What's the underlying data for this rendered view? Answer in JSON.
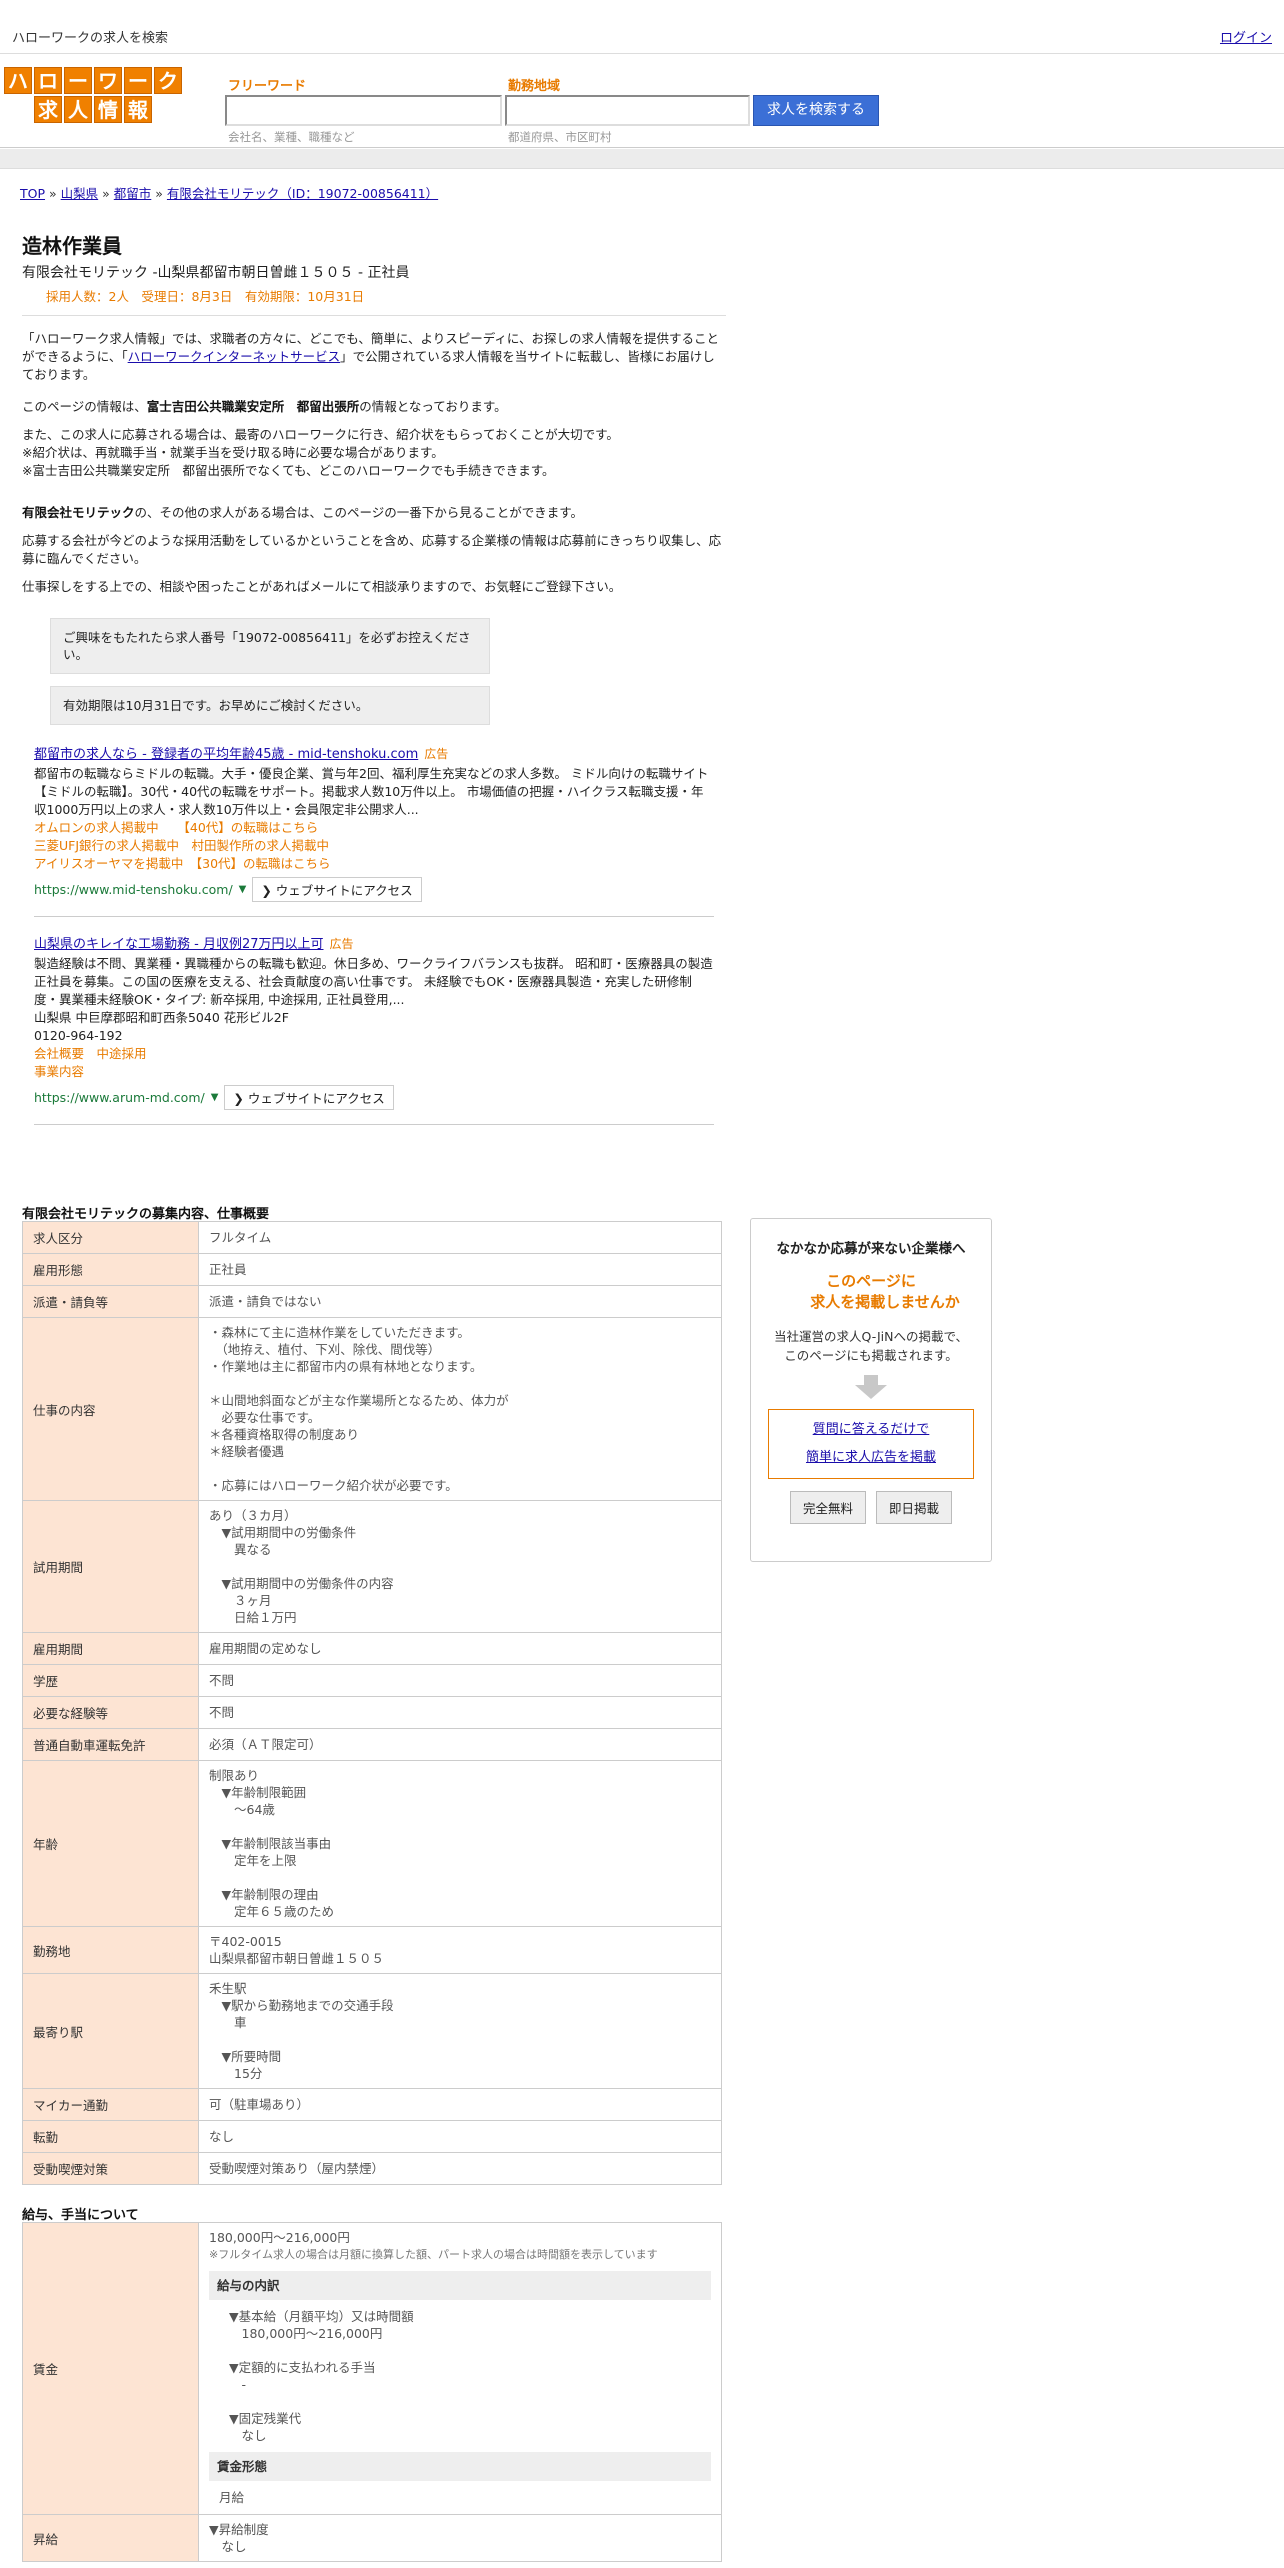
{
  "topbar": {
    "site_title": "ハローワークの求人を検索",
    "login": "ログイン"
  },
  "header": {
    "logo_row1": [
      "ハ",
      "ロ",
      "ー",
      "ワ",
      "ー",
      "ク"
    ],
    "logo_row2": [
      "求",
      "人",
      "情",
      "報"
    ],
    "freeword_label": "フリーワード",
    "freeword_hint": "会社名、業種、職種など",
    "area_label": "勤務地域",
    "area_hint": "都道府県、市区町村",
    "search_button": "求人を検索する"
  },
  "breadcrumb": {
    "items": [
      "TOP",
      "山梨県",
      "都留市",
      "有限会社モリテック（ID：19072-00856411）"
    ],
    "separator": "»"
  },
  "job": {
    "title": "造林作業員",
    "company_line": "有限会社モリテック -山梨県都留市朝日曽雌１５０５ - 正社員",
    "meta": "採用人数：2人　受理日：8月3日　有効期限：10月31日"
  },
  "intro": {
    "p1_a": "「ハローワーク求人情報」では、求職者の方々に、どこでも、簡単に、よりスピーディに、お探しの求人情報を提供することができるように、「",
    "p1_link": "ハローワークインターネットサービス",
    "p1_b": "」で公開されている求人情報を当サイトに転載し、皆様にお届けしております。",
    "p2_a": "このページの情報は、",
    "p2_bold": "富士吉田公共職業安定所　都留出張所",
    "p2_b": "の情報となっております。",
    "p3": "また、この求人に応募される場合は、最寄のハローワークに行き、紹介状をもらっておくことが大切です。\n※紹介状は、再就職手当・就業手当を受け取る時に必要な場合があります。\n※富士吉田公共職業安定所　都留出張所でなくても、どこのハローワークでも手続きできます。",
    "p4_bold": "有限会社モリテック",
    "p4_b": "の、その他の求人がある場合は、このページの一番下から見ることができます。",
    "p5": "応募する会社が今どのような採用活動をしているかということを含め、応募する企業様の情報は応募前にきっちり収集し、応募に臨んでください。",
    "p6": "仕事探しをする上での、相談や困ったことがあればメールにて相談承りますので、お気軽にご登録下さい。",
    "notice1": "ご興味をもたれたら求人番号「19072-00856411」を必ずお控えください。",
    "notice2": "有効期限は10月31日です。お早めにご検討ください。"
  },
  "ads": [
    {
      "title": "都留市の求人なら - 登録者の平均年齢45歳 - mid-tenshoku.com",
      "tag": "広告",
      "desc": "都留市の転職ならミドルの転職。大手・優良企業、賞与年2回、福利厚生充実などの求人多数。 ミドル向けの転職サイト【ミドルの転職】。30代・40代の転職をサポート。掲載求人数10万件以上。 市場価値の把握・ハイクラス転職支援・年収1000万円以上の求人・求人数10万件以上・会員限定非公開求人...",
      "links": [
        "オムロンの求人掲載中　　【40代】の転職はこちら",
        "三菱UFJ銀行の求人掲載中　村田製作所の求人掲載中",
        "アイリスオーヤマを掲載中　【30代】の転職はこちら"
      ],
      "url": "https://www.mid-tenshoku.com/",
      "visit": "❯ ウェブサイトにアクセス"
    },
    {
      "title": "山梨県のキレイな工場勤務 - 月収例27万円以上可",
      "tag": "広告",
      "desc": "製造経験は不問、異業種・異職種からの転職も歓迎。休日多め、ワークライフバランスも抜群。 昭和町・医療器具の製造正社員を募集。この国の医療を支える、社会貢献度の高い仕事です。 未経験でもOK・医療器具製造・充実した研修制度・異業種未経験OK・タイプ: 新卒採用, 中途採用, 正社員登用,...\n山梨県 中巨摩郡昭和町西条5040 花形ビル2F\n0120-964-192",
      "links": [
        "会社概要　中途採用",
        "事業内容"
      ],
      "url": "https://www.arum-md.com/",
      "visit": "❯ ウェブサイトにアクセス"
    }
  ],
  "job_summary": {
    "title": "有限会社モリテックの募集内容、仕事概要",
    "rows": [
      {
        "label": "求人区分",
        "value": "フルタイム"
      },
      {
        "label": "雇用形態",
        "value": "正社員"
      },
      {
        "label": "派遣・請負等",
        "value": "派遣・請負ではない"
      },
      {
        "label": "仕事の内容",
        "value": "・森林にて主に造林作業をしていただきます。\n　（地拵え、植付、下刈、除伐、間伐等）\n・作業地は主に都留市内の県有林地となります。\n\n＊山間地斜面などが主な作業場所となるため、体力が\n　必要な仕事です。\n＊各種資格取得の制度あり\n＊経験者優遇\n\n・応募にはハローワーク紹介状が必要です。"
      },
      {
        "label": "試用期間",
        "value": "あり（３カ月）\n　▼試用期間中の労働条件\n　　異なる\n\n　▼試用期間中の労働条件の内容\n　　３ヶ月\n　　日給１万円"
      },
      {
        "label": "雇用期間",
        "value": "雇用期間の定めなし"
      },
      {
        "label": "学歴",
        "value": "不問"
      },
      {
        "label": "必要な経験等",
        "value": "不問"
      },
      {
        "label": "普通自動車運転免許",
        "value": "必須（ＡＴ限定可）"
      },
      {
        "label": "年齢",
        "value": "制限あり\n　▼年齢制限範囲\n　　〜64歳\n\n　▼年齢制限該当事由\n　　定年を上限\n\n　▼年齢制限の理由\n　　定年６５歳のため"
      },
      {
        "label": "勤務地",
        "value": "〒402-0015\n山梨県都留市朝日曽雌１５０５"
      },
      {
        "label": "最寄り駅",
        "value": "禾生駅\n　▼駅から勤務地までの交通手段\n　　車\n\n　▼所要時間\n　　15分"
      },
      {
        "label": "マイカー通勤",
        "value": "可（駐車場あり）"
      },
      {
        "label": "転勤",
        "value": "なし"
      },
      {
        "label": "受動喫煙対策",
        "value": "受動喫煙対策あり（屋内禁煙）"
      }
    ]
  },
  "pay": {
    "title": "給与、手当について",
    "wage_label": "賃金",
    "wage_value": "180,000円〜216,000円",
    "wage_note": "※フルタイム求人の場合は月額に換算した額、パート求人の場合は時間額を表示しています",
    "breakdown_head": "給与の内訳",
    "breakdown": "▼基本給（月額平均）又は時間額\n　180,000円〜216,000円\n\n▼定額的に支払われる手当\n　-\n\n▼固定残業代\n　なし",
    "form_head": "賃金形態",
    "form_value": "月給",
    "raise_label": "昇給",
    "raise_value": "▼昇給制度\n　なし"
  },
  "sidebox": {
    "title": "なかなか応募が来ない企業様へ",
    "catch_line1": "このページに",
    "catch_line2": "求人を掲載しませんか",
    "body": "当社運営の求人Q-JiNへの掲載で、\nこのページにも掲載されます。",
    "link1": "質問に答えるだけで",
    "link2": "簡単に求人広告を掲載",
    "btn1": "完全無料",
    "btn2": "即日掲載"
  }
}
